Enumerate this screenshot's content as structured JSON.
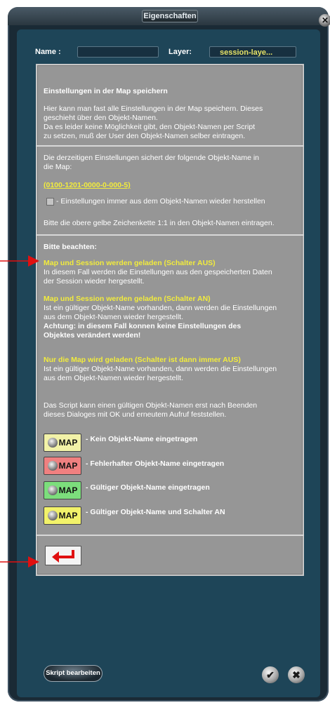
{
  "window": {
    "title": "Eigenschaften"
  },
  "fields": {
    "name_label": "Name :",
    "name_value": "",
    "layer_label": "Layer:",
    "layer_value": "session-laye..."
  },
  "section1": {
    "heading": "Einstellungen in der Map speichern",
    "body": "Hier kann man fast alle Einstellungen in der Map speichern. Dieses\ngeschieht über den Objekt-Namen.\nDa es leider keine Möglichkeit gibt, den Objekt-Namen per Script\nzu setzen, muß der User den Objekt-Namen selber eintragen."
  },
  "section2": {
    "intro": "Die derzeitigen Einstellungen sichert der folgende Objekt-Name in\ndie Map:",
    "code": "(0100-1201-0000-0-000-5)",
    "checkbox_label": "- Einstellungen immer aus dem Objekt-Namen wieder herstellen",
    "checkbox_checked": false,
    "instruction": "Bitte die obere gelbe Zeichenkette 1:1 in den Objekt-Namen eintragen."
  },
  "section3": {
    "heading": "Bitte beachten:",
    "item1_title": "Map und Session werden geladen (Schalter AUS)",
    "item1_body": "In diesem Fall werden die Einstellungen aus den gespeicherten Daten\nder Session wieder hergestellt.",
    "item2_title": "Map und Session werden geladen (Schalter AN)",
    "item2_body": "Ist ein gültiger Objekt-Name vorhanden, dann werden die Einstellungen\naus dem Objekt-Namen wieder hergestellt.",
    "item2_warning": "Achtung: in diesem Fall konnen keine Einstellungen des\nObjektes verändert werden!",
    "item3_title": "Nur die Map wird geladen (Schalter ist dann immer AUS)",
    "item3_body": "Ist ein gültiger Objekt-Name vorhanden, dann werden die Einstellungen\naus dem Objekt-Namen wieder hergestellt.",
    "footer": "Das Script kann einen gültigen Objekt-Namen erst nach Beenden\ndieses Dialoges mit OK und erneutem Aufruf feststellen."
  },
  "legend": [
    {
      "icon_label": "MAP",
      "bg": "#f2f2a8",
      "text": "- Kein Objekt-Name eingetragen"
    },
    {
      "icon_label": "MAP",
      "bg": "#f08080",
      "text": "- Fehlerhafter Objekt-Name eingetragen"
    },
    {
      "icon_label": "MAP",
      "bg": "#7cde7c",
      "text": "- Gültiger Objekt-Name eingetragen"
    },
    {
      "icon_label": "MAP",
      "bg": "#f2f26a",
      "text": "- Gültiger Objekt-Name und Schalter AN"
    }
  ],
  "buttons": {
    "edit_script": "Skript bearbeiten",
    "ok_glyph": "✔",
    "cancel_glyph": "✖",
    "close_glyph": "✕"
  },
  "colors": {
    "accent_yellow": "#f2ec3c",
    "panel_gray": "#969696",
    "window_blue": "#1e4558",
    "pointer_red": "#e01010"
  }
}
